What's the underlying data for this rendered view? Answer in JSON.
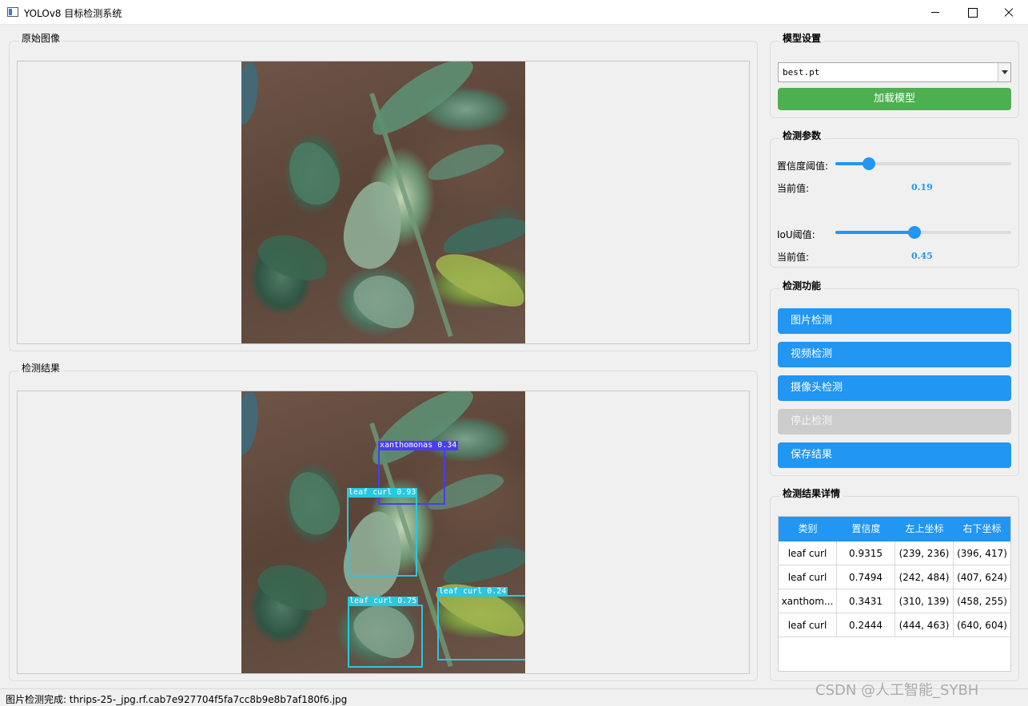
{
  "window": {
    "title": "YOLOv8 目标检测系统"
  },
  "original": {
    "title": "原始图像"
  },
  "result": {
    "title": "检测结果",
    "boxes": [
      {
        "label": "xanthomonas 0.34",
        "color": "#4a3cf0"
      },
      {
        "label": "leaf curl 0.93",
        "color": "#28c8e0"
      },
      {
        "label": "leaf curl 0.75",
        "color": "#28c8e0"
      },
      {
        "label": "leaf curl 0.24",
        "color": "#28c8e0"
      }
    ]
  },
  "model": {
    "title": "模型设置",
    "selected": "best.pt",
    "load_label": "加载模型"
  },
  "params": {
    "title": "检测参数",
    "conf_label": "置信度阈值:",
    "conf_current_label": "当前值:",
    "conf_value": "0.19",
    "conf_fraction": 0.19,
    "iou_label": "IoU阈值:",
    "iou_current_label": "当前值:",
    "iou_value": "0.45",
    "iou_fraction": 0.45
  },
  "functions": {
    "title": "检测功能",
    "image_label": "图片检测",
    "video_label": "视频检测",
    "camera_label": "摄像头检测",
    "stop_label": "停止检测",
    "save_label": "保存结果"
  },
  "details": {
    "title": "检测结果详情",
    "headers": [
      "类别",
      "置信度",
      "左上坐标",
      "右下坐标"
    ],
    "rows": [
      [
        "leaf curl",
        "0.9315",
        "(239, 236)",
        "(396, 417)"
      ],
      [
        "leaf curl",
        "0.7494",
        "(242, 484)",
        "(407, 624)"
      ],
      [
        "xanthom...",
        "0.3431",
        "(310, 139)",
        "(458, 255)"
      ],
      [
        "leaf curl",
        "0.2444",
        "(444, 463)",
        "(640, 604)"
      ]
    ]
  },
  "status": {
    "text": "图片检测完成: thrips-25-_jpg.rf.cab7e927704f5fa7cc8b9e8b7af180f6.jpg"
  },
  "watermark": "CSDN @人工智能_SYBH",
  "colors": {
    "accent": "#2196f3",
    "load_button": "#4caf50",
    "disabled": "#cccccc"
  }
}
